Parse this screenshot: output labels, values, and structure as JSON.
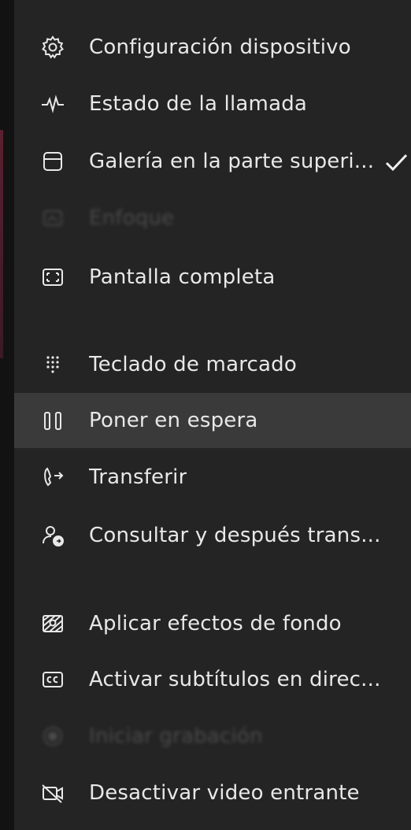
{
  "menu": {
    "items": [
      {
        "label": "Configuración dispositivo",
        "icon": "gear-icon"
      },
      {
        "label": "Estado de la llamada",
        "icon": "pulse-icon"
      },
      {
        "label": "Galería en la parte superi...",
        "icon": "gallery-top-icon",
        "checked": true
      },
      {
        "label": "Enfoque",
        "icon": "focus-icon",
        "disabled": true
      },
      {
        "label": "Pantalla completa",
        "icon": "fullscreen-icon"
      },
      {
        "label": "Teclado de marcado",
        "icon": "dialpad-icon"
      },
      {
        "label": "Poner en espera",
        "icon": "pause-icon",
        "highlighted": true
      },
      {
        "label": "Transferir",
        "icon": "transfer-icon"
      },
      {
        "label": "Consultar y después trans...",
        "icon": "consult-transfer-icon"
      },
      {
        "label": "Aplicar efectos de fondo",
        "icon": "background-effects-icon"
      },
      {
        "label": "Activar subtítulos en direc...",
        "icon": "captions-icon"
      },
      {
        "label": "Iniciar grabación",
        "icon": "record-icon",
        "disabled": true
      },
      {
        "label": "Desactivar video entrante",
        "icon": "video-off-icon"
      }
    ]
  },
  "colors": {
    "background": "#242424",
    "highlight": "#3a3a3a",
    "text": "#e8e8e8",
    "disabled": "#4a4a4a"
  }
}
